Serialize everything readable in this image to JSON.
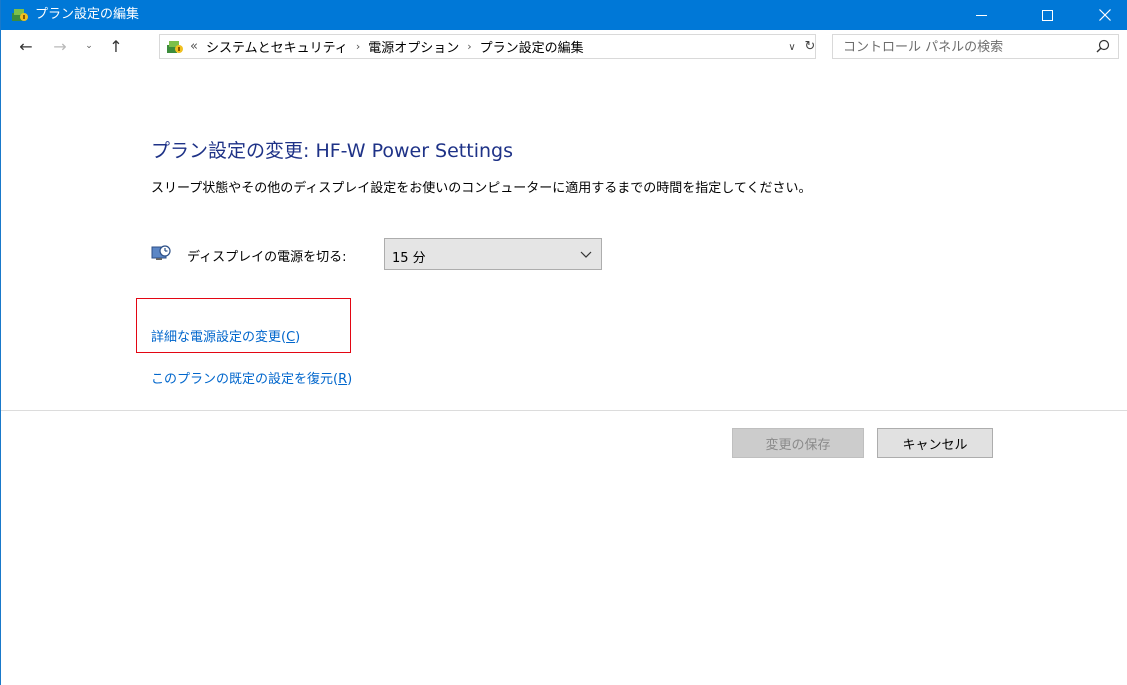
{
  "window": {
    "title": "プラン設定の編集"
  },
  "nav": {
    "breadcrumb_overflow": "«",
    "breadcrumbs": [
      "システムとセキュリティ",
      "電源オプション",
      "プラン設定の編集"
    ],
    "search_placeholder": "コントロール パネルの検索"
  },
  "main": {
    "heading": "プラン設定の変更: HF-W Power Settings",
    "description": "スリープ状態やその他のディスプレイ設定をお使いのコンピューターに適用するまでの時間を指定してください。",
    "display_off_label": "ディスプレイの電源を切る:",
    "display_off_value": "15 分",
    "link_advanced_text": "詳細な電源設定の変更(",
    "link_advanced_key": "C",
    "link_advanced_close": ")",
    "link_restore_text": "このプランの既定の設定を復元(",
    "link_restore_key": "R",
    "link_restore_close": ")"
  },
  "buttons": {
    "save": "変更の保存",
    "cancel": "キャンセル"
  },
  "colors": {
    "titlebar": "#0078d7",
    "heading": "#1e3287",
    "link": "#0066cc",
    "highlight": "#e30613"
  }
}
